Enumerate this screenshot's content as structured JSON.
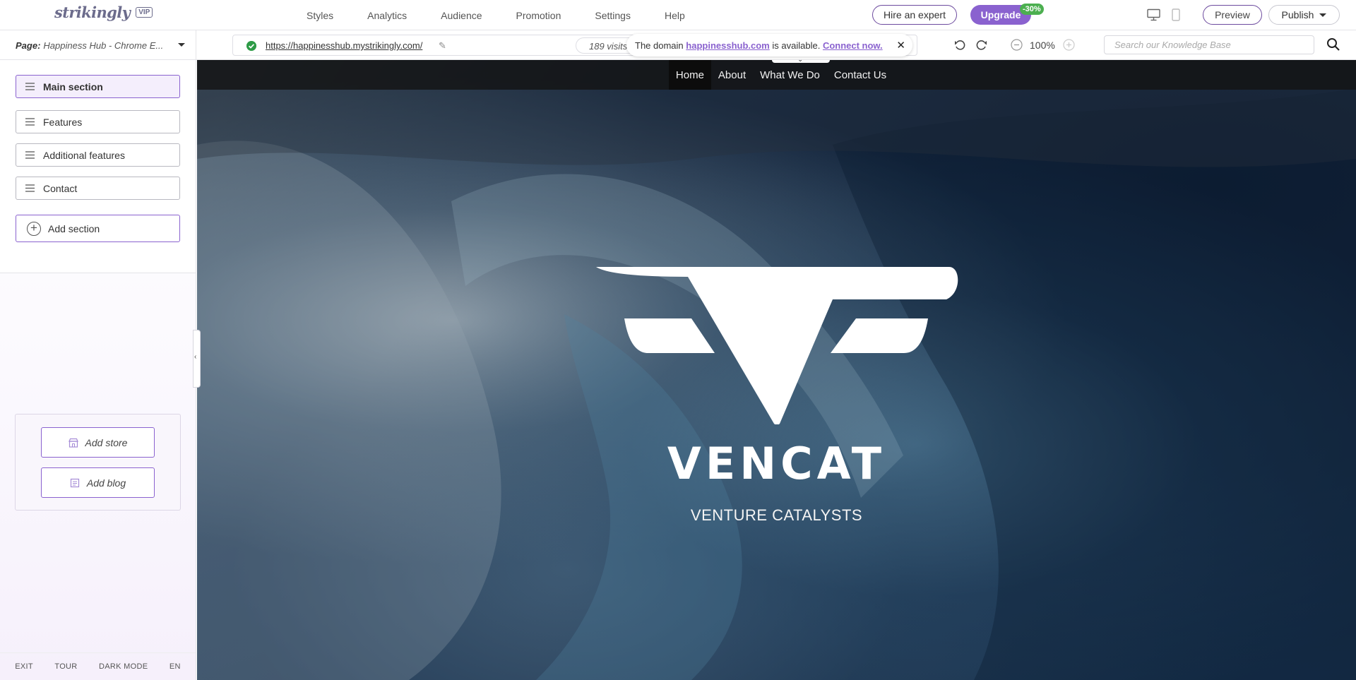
{
  "app": {
    "logo_text": "strikingly",
    "vip_label": "VIP"
  },
  "top_nav": [
    {
      "label": "Styles"
    },
    {
      "label": "Analytics"
    },
    {
      "label": "Audience"
    },
    {
      "label": "Promotion"
    },
    {
      "label": "Settings"
    },
    {
      "label": "Help"
    }
  ],
  "topbar": {
    "hire_expert_label": "Hire an expert",
    "upgrade_label": "Upgrade",
    "discount_badge": "-30%",
    "preview_label": "Preview",
    "publish_label": "Publish"
  },
  "subbar": {
    "page_label": "Page:",
    "page_value": "Happiness Hub - Chrome E...",
    "url": "https://happinesshub.mystrikingly.com/",
    "visits": "189 visits",
    "domain_notice": {
      "prefix": "The domain",
      "domain": "happinesshub.com",
      "middle": "is available.",
      "action": "Connect now."
    },
    "zoom_level": "100%",
    "kb_search_placeholder": "Search our Knowledge Base"
  },
  "sidebar": {
    "sections": [
      {
        "label": "Main section",
        "active": true
      },
      {
        "label": "Features",
        "active": false
      },
      {
        "label": "Additional features",
        "active": false
      },
      {
        "label": "Contact",
        "active": false
      }
    ],
    "add_section_label": "Add section",
    "add_store_label": "Add store",
    "add_blog_label": "Add blog",
    "footer": [
      {
        "label": "EXIT"
      },
      {
        "label": "TOUR"
      },
      {
        "label": "DARK MODE"
      },
      {
        "label": "EN"
      }
    ]
  },
  "site": {
    "nav": [
      {
        "label": "Home",
        "active": true
      },
      {
        "label": "About",
        "active": false
      },
      {
        "label": "What We Do",
        "active": false
      },
      {
        "label": "Contact Us",
        "active": false
      }
    ],
    "brand_name": "VENCAT",
    "tagline": "VENTURE CATALYSTS"
  },
  "colors": {
    "accent": "#8a62cf",
    "accent_dark": "#6c4a9e",
    "discount": "#4caf50",
    "url_check": "#2e9b47"
  },
  "icons": {
    "desktop": "desktop-icon",
    "mobile": "mobile-icon",
    "undo": "undo-icon",
    "redo": "redo-icon",
    "zoom_out": "zoom-out-icon",
    "zoom_in": "zoom-in-icon",
    "search": "search-icon"
  }
}
